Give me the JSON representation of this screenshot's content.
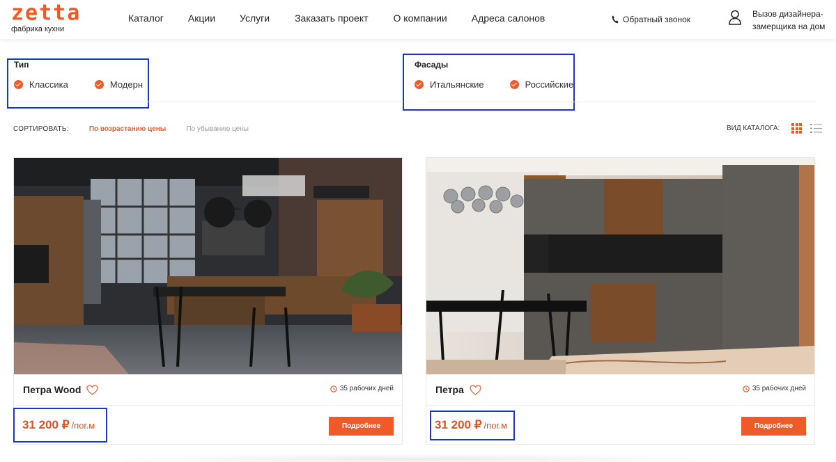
{
  "header": {
    "logo_word": "zetta",
    "logo_sub": "фабрика кухни",
    "nav": [
      "Каталог",
      "Акции",
      "Услуги",
      "Заказать проект",
      "О компании",
      "Адреса салонов"
    ],
    "callback": "Обратный звонок",
    "designer_call": "Вызов дизайнера-замерщика на дом"
  },
  "filters": {
    "type": {
      "title": "Тип",
      "options": [
        "Классика",
        "Модерн"
      ]
    },
    "facades": {
      "title": "Фасады",
      "options": [
        "Итальянские",
        "Российские"
      ]
    }
  },
  "sort": {
    "label": "СОРТИРОВАТЬ:",
    "asc": "По возрастанию цены",
    "desc": "По убыванию цены",
    "view_label": "ВИД КАТАЛОГА:"
  },
  "colors": {
    "accent": "#f05a28",
    "highlight": "#1638c9"
  },
  "products": [
    {
      "name": "Петра Wood",
      "days": "35 рабочих дней",
      "price": "31 200 ₽",
      "unit": "/пог.м",
      "button": "Подробнее"
    },
    {
      "name": "Петра",
      "days": "35 рабочих дней",
      "price": "31 200 ₽",
      "unit": "/пог.м",
      "button": "Подробнее"
    }
  ]
}
